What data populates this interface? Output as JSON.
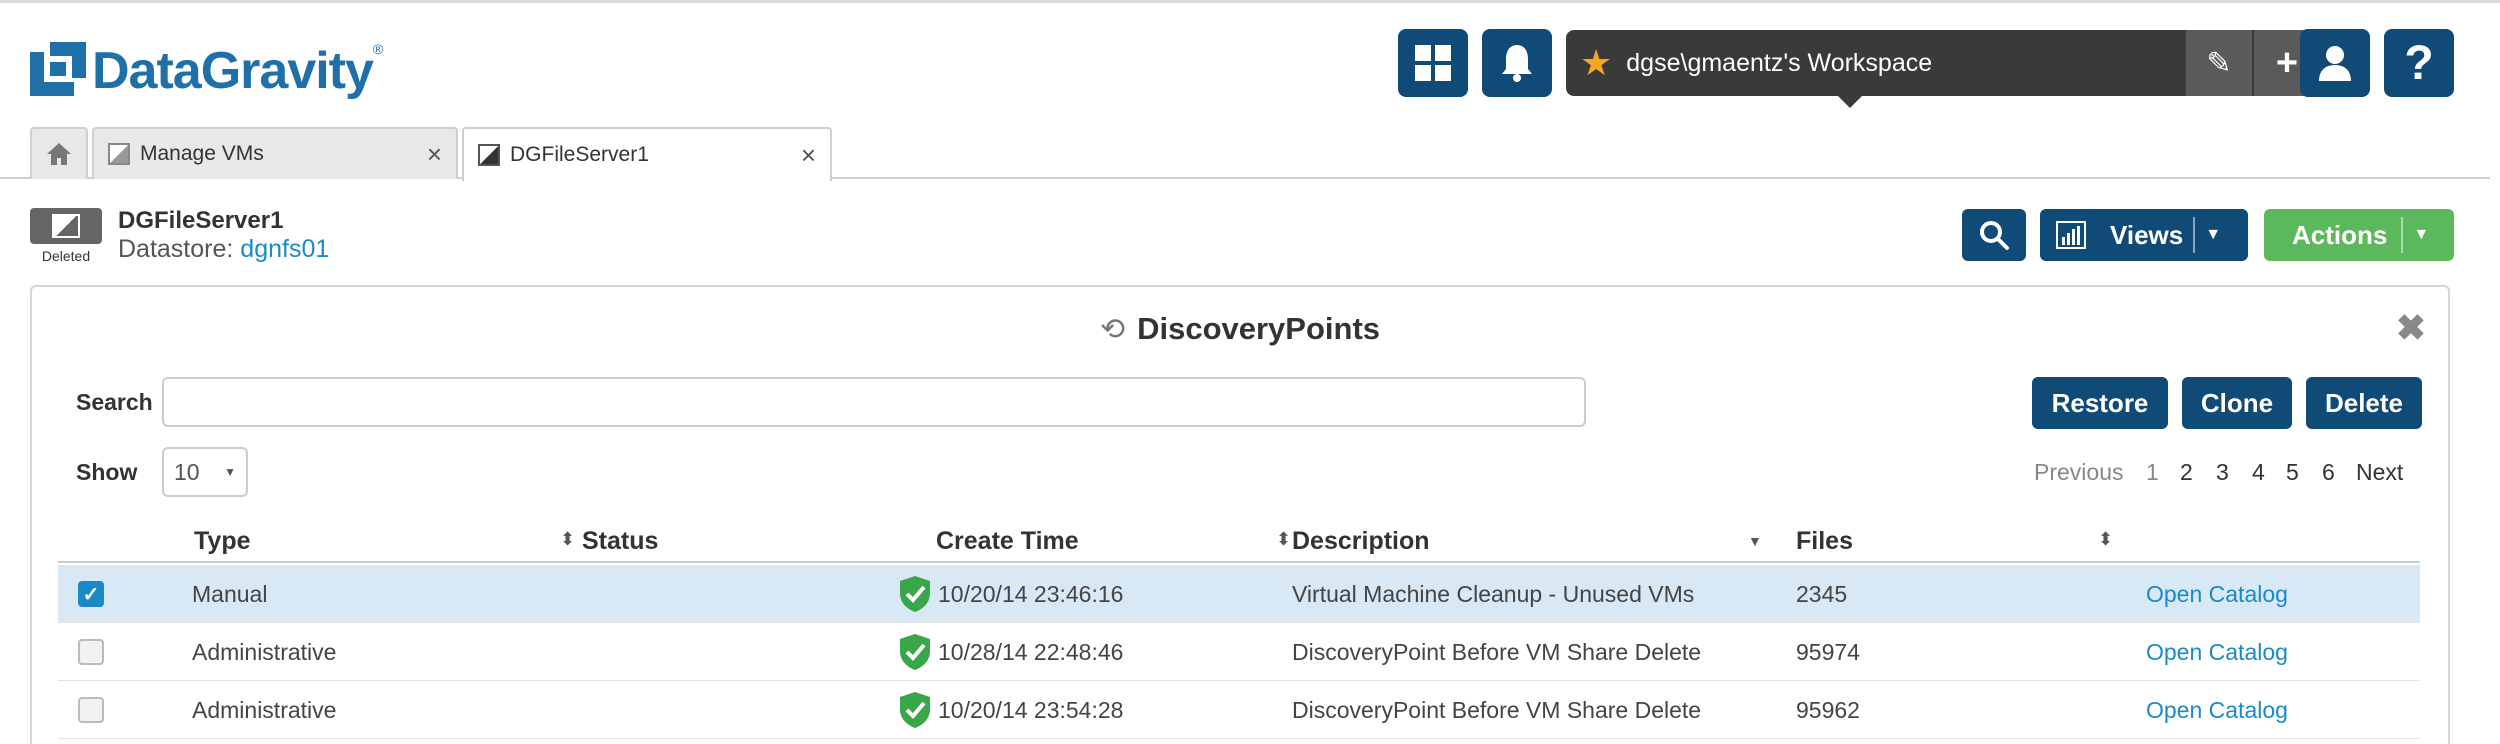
{
  "brand": {
    "name": "DataGravity",
    "tm": "®"
  },
  "workspace": {
    "label": "dgse\\gmaentz's Workspace"
  },
  "tabs": [
    {
      "label": "Manage VMs",
      "close": "×"
    },
    {
      "label": "DGFileServer1",
      "close": "×"
    }
  ],
  "vm": {
    "name": "DGFileServer1",
    "badge": "Deleted",
    "datastore_label": "Datastore:",
    "datastore": "dgnfs01"
  },
  "header_buttons": {
    "views": "Views",
    "actions": "Actions"
  },
  "panel": {
    "title": "DiscoveryPoints",
    "search_label": "Search",
    "search_placeholder": "",
    "show_label": "Show",
    "show_value": "10",
    "buttons": {
      "restore": "Restore",
      "clone": "Clone",
      "delete": "Delete"
    },
    "pager": {
      "previous": "Previous",
      "pages": [
        "1",
        "2",
        "3",
        "4",
        "5",
        "6"
      ],
      "next": "Next",
      "current": "1"
    }
  },
  "table": {
    "columns": {
      "type": "Type",
      "status": "Status",
      "create_time": "Create Time",
      "description": "Description",
      "files": "Files"
    },
    "rows": [
      {
        "selected": true,
        "type": "Manual",
        "create_time": "10/20/14 23:46:16",
        "description": "Virtual Machine Cleanup - Unused VMs",
        "files": "2345",
        "action": "Open Catalog"
      },
      {
        "selected": false,
        "type": "Administrative",
        "create_time": "10/28/14 22:48:46",
        "description": "DiscoveryPoint Before VM Share Delete",
        "files": "95974",
        "action": "Open Catalog"
      },
      {
        "selected": false,
        "type": "Administrative",
        "create_time": "10/20/14 23:54:28",
        "description": "DiscoveryPoint Before VM Share Delete",
        "files": "95962",
        "action": "Open Catalog"
      }
    ]
  },
  "colors": {
    "primary": "#104b78",
    "accent": "#1a8ac6",
    "success": "#5cb85c",
    "star": "#f5a623"
  },
  "icons": [
    "grid-icon",
    "bell-icon",
    "star-icon",
    "pencil-icon",
    "plus-icon",
    "user-icon",
    "help-icon",
    "home-icon",
    "vm-icon",
    "search-icon",
    "chart-icon",
    "history-icon",
    "close-icon",
    "shield-check-icon",
    "sort-icon"
  ]
}
